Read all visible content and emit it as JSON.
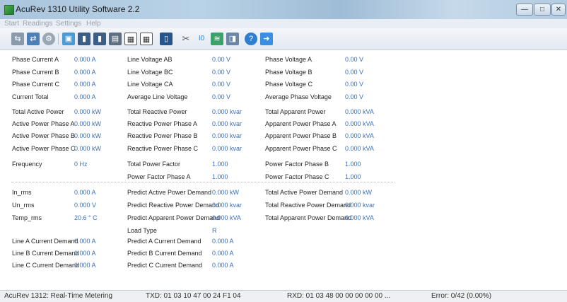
{
  "window": {
    "title": "AcuRev 1310 Utility Software 2.2",
    "controls": {
      "minimize": "—",
      "maximize": "□",
      "close": "✕"
    }
  },
  "menu": [
    "Start",
    "Readings",
    "Settings",
    "Help"
  ],
  "toolbar": {
    "icons": [
      "disconnect-icon",
      "connect-icon",
      "settings-gear-icon",
      "monitor-icon",
      "device-icon",
      "device-alt-icon",
      "log-icon",
      "calendar-icon",
      "schedule-icon",
      "document-icon",
      "tools-icon",
      "io-icon",
      "chart-icon",
      "image-icon",
      "help-icon",
      "export-icon"
    ]
  },
  "readings": {
    "col1": [
      {
        "label": "Phase Current A",
        "value": "0.000 A"
      },
      {
        "label": "Phase Current B",
        "value": "0.000 A"
      },
      {
        "label": "Phase Current C",
        "value": "0.000 A"
      },
      {
        "label": "Current Total",
        "value": "0.000 A"
      },
      {
        "label": "Total Active Power",
        "value": "0.000 kW"
      },
      {
        "label": "Active Power Phase A",
        "value": "0.000 kW"
      },
      {
        "label": "Active Power Phase B",
        "value": "0.000 kW"
      },
      {
        "label": "Active Power Phase C",
        "value": "0.000 kW"
      },
      {
        "label": "Frequency",
        "value": "0 Hz"
      },
      {
        "label": "In_rms",
        "value": "0.000 A"
      },
      {
        "label": "Un_rms",
        "value": "0.000 V"
      },
      {
        "label": "Temp_rms",
        "value": "20.6 ° C"
      },
      {
        "label": "Line A Current Demand",
        "value": "0.000 A"
      },
      {
        "label": "Line B Current Demand",
        "value": "0.000 A"
      },
      {
        "label": "Line C Current Demand",
        "value": "0.000 A"
      }
    ],
    "col2": [
      {
        "label": "Line Voltage AB",
        "value": "0.00 V"
      },
      {
        "label": "Line Voltage BC",
        "value": "0.00 V"
      },
      {
        "label": "Line Voltage CA",
        "value": "0.00 V"
      },
      {
        "label": "Average Line Voltage",
        "value": "0.00 V"
      },
      {
        "label": "Total Reactive Power",
        "value": "0.000 kvar"
      },
      {
        "label": "Reactive Power Phase A",
        "value": "0.000 kvar"
      },
      {
        "label": "Reactive Power Phase B",
        "value": "0.000 kvar"
      },
      {
        "label": "Reactive Power Phase C",
        "value": "0.000 kvar"
      },
      {
        "label": "Total Power Factor",
        "value": "1.000"
      },
      {
        "label": "Power Factor Phase A",
        "value": "1.000"
      },
      {
        "label": "Predict Active Power Demand",
        "value": "0.000 kW"
      },
      {
        "label": "Predict Reactive Power Demand",
        "value": "0.000 kvar"
      },
      {
        "label": "Predict Apparent Power Demand",
        "value": "0.000 kVA"
      },
      {
        "label": "Load Type",
        "value": "R"
      },
      {
        "label": "Predict A Current Demand",
        "value": "0.000 A"
      },
      {
        "label": "Predict B Current Demand",
        "value": "0.000 A"
      },
      {
        "label": "Predict C Current Demand",
        "value": "0.000 A"
      }
    ],
    "col3": [
      {
        "label": "Phase Voltage A",
        "value": "0.00 V"
      },
      {
        "label": "Phase Voltage B",
        "value": "0.00 V"
      },
      {
        "label": "Phase Voltage C",
        "value": "0.00 V"
      },
      {
        "label": "Average Phase Voltage",
        "value": "0.00 V"
      },
      {
        "label": "Total Apparent Power",
        "value": "0.000 kVA"
      },
      {
        "label": "Apparent Power Phase A",
        "value": "0.000 kVA"
      },
      {
        "label": "Apparent Power Phase B",
        "value": "0.000 kVA"
      },
      {
        "label": "Apparent Power Phase C",
        "value": "0.000 kVA"
      },
      {
        "label": "Power Factor Phase B",
        "value": "1.000"
      },
      {
        "label": "Power Factor Phase C",
        "value": "1.000"
      },
      {
        "label": "Total Active Power Demand",
        "value": "0.000 kW"
      },
      {
        "label": "Total Reactive Power Demand",
        "value": "0.000 kvar"
      },
      {
        "label": "Total Apparent Power Demand",
        "value": "0.000 kVA"
      }
    ]
  },
  "status": {
    "mode": "AcuRev 1312: Real-Time Metering",
    "txd": "TXD:  01 03 10 47 00 24 F1 04",
    "rxd": "RXD:  01 03 48 00 00 00 00 00 ...",
    "error": "Error:  0/42  (0.00%)"
  }
}
